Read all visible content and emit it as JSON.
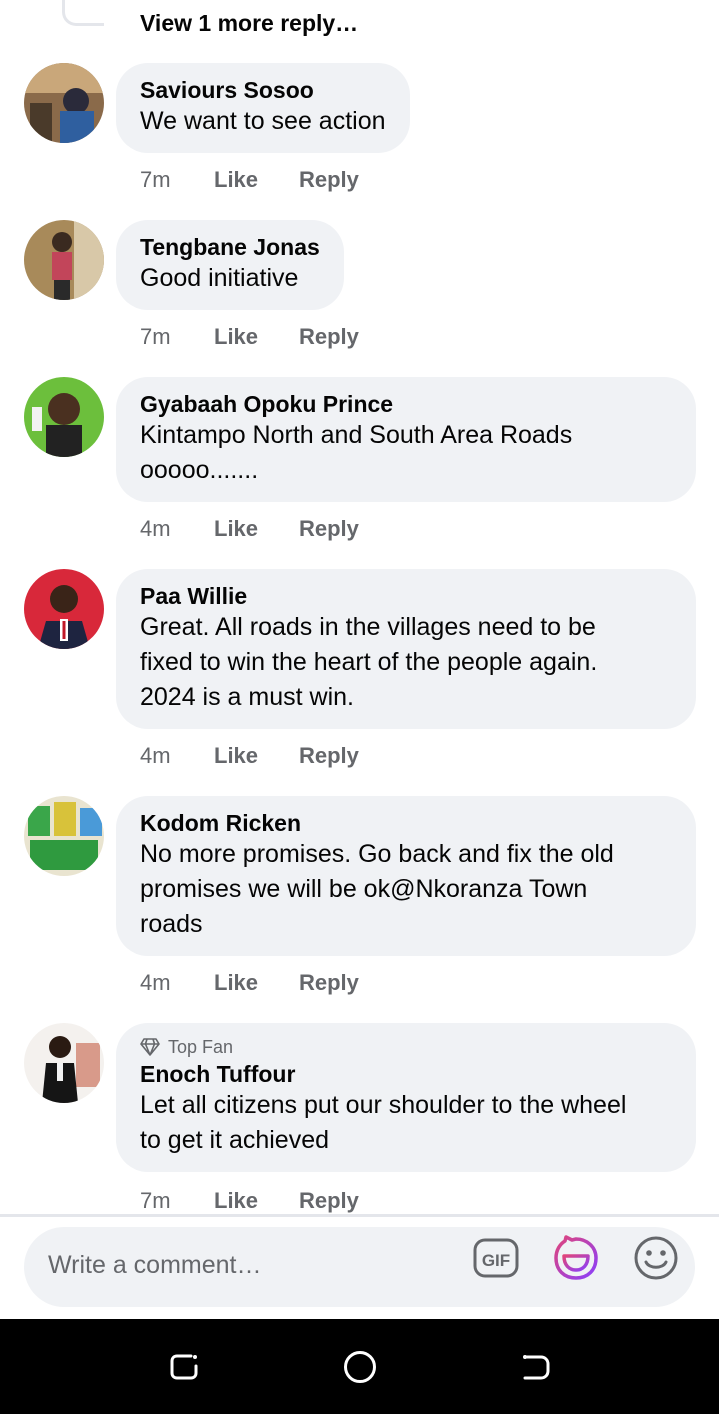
{
  "thread": {
    "view_more": "View 1 more reply…",
    "comments": [
      {
        "author": "Saviours Sosoo",
        "top_fan": "",
        "text": [
          "We want to see action"
        ],
        "time": "7m",
        "like": "Like",
        "reply": "Reply"
      },
      {
        "author": "Tengbane Jonas",
        "top_fan": "",
        "text": [
          "Good initiative"
        ],
        "time": "7m",
        "like": "Like",
        "reply": "Reply"
      },
      {
        "author": "Gyabaah Opoku Prince",
        "top_fan": "",
        "text": [
          "Kintampo North and South Area Roads",
          "ooooo......."
        ],
        "time": "4m",
        "like": "Like",
        "reply": "Reply"
      },
      {
        "author": "Paa Willie",
        "top_fan": "",
        "text": [
          "Great. All roads in the villages need to be",
          "fixed to win the heart of the people again.",
          "2024 is a must win."
        ],
        "time": "4m",
        "like": "Like",
        "reply": "Reply"
      },
      {
        "author": "Kodom Ricken",
        "top_fan": "",
        "text": [
          "No more promises. Go back and fix the old",
          "promises we will be ok@Nkoranza Town",
          "roads"
        ],
        "time": "4m",
        "like": "Like",
        "reply": "Reply"
      },
      {
        "author": "Enoch Tuffour",
        "top_fan": "Top Fan",
        "text": [
          "Let all citizens put our shoulder to the wheel",
          "to get it achieved"
        ],
        "time": "7m",
        "like": "Like",
        "reply": "Reply"
      }
    ]
  },
  "composer": {
    "placeholder": "Write a comment…",
    "icons": [
      "gif-icon",
      "avatar-sticker-icon",
      "emoji-icon"
    ]
  },
  "navbar": {
    "icons": [
      "recent-apps-icon",
      "home-icon",
      "back-icon"
    ]
  },
  "colors": {
    "bubble": "#f0f2f5",
    "secondary_text": "#65676b",
    "sticker_gradient_start": "#e0457b",
    "sticker_gradient_end": "#8a3ffc"
  }
}
